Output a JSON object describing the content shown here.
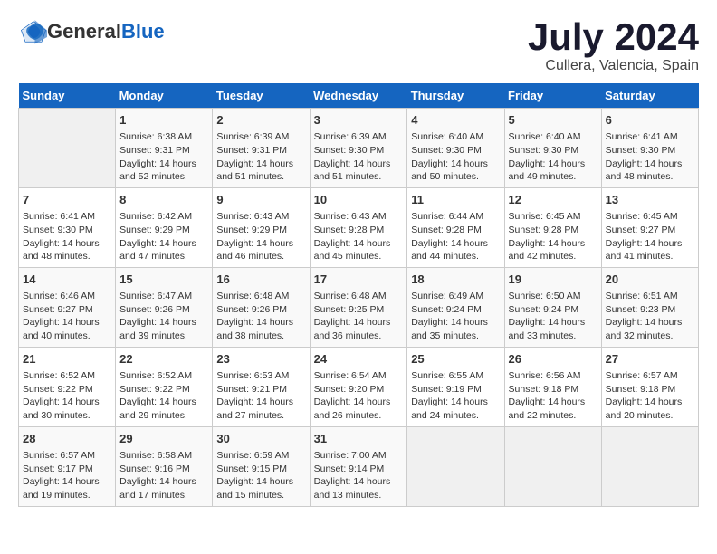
{
  "logo": {
    "general": "General",
    "blue": "Blue"
  },
  "header": {
    "month_year": "July 2024",
    "location": "Cullera, Valencia, Spain"
  },
  "weekdays": [
    "Sunday",
    "Monday",
    "Tuesday",
    "Wednesday",
    "Thursday",
    "Friday",
    "Saturday"
  ],
  "weeks": [
    [
      {
        "day": "",
        "sunrise": "",
        "sunset": "",
        "daylight": ""
      },
      {
        "day": "1",
        "sunrise": "Sunrise: 6:38 AM",
        "sunset": "Sunset: 9:31 PM",
        "daylight": "Daylight: 14 hours and 52 minutes."
      },
      {
        "day": "2",
        "sunrise": "Sunrise: 6:39 AM",
        "sunset": "Sunset: 9:31 PM",
        "daylight": "Daylight: 14 hours and 51 minutes."
      },
      {
        "day": "3",
        "sunrise": "Sunrise: 6:39 AM",
        "sunset": "Sunset: 9:30 PM",
        "daylight": "Daylight: 14 hours and 51 minutes."
      },
      {
        "day": "4",
        "sunrise": "Sunrise: 6:40 AM",
        "sunset": "Sunset: 9:30 PM",
        "daylight": "Daylight: 14 hours and 50 minutes."
      },
      {
        "day": "5",
        "sunrise": "Sunrise: 6:40 AM",
        "sunset": "Sunset: 9:30 PM",
        "daylight": "Daylight: 14 hours and 49 minutes."
      },
      {
        "day": "6",
        "sunrise": "Sunrise: 6:41 AM",
        "sunset": "Sunset: 9:30 PM",
        "daylight": "Daylight: 14 hours and 48 minutes."
      }
    ],
    [
      {
        "day": "7",
        "sunrise": "Sunrise: 6:41 AM",
        "sunset": "Sunset: 9:30 PM",
        "daylight": "Daylight: 14 hours and 48 minutes."
      },
      {
        "day": "8",
        "sunrise": "Sunrise: 6:42 AM",
        "sunset": "Sunset: 9:29 PM",
        "daylight": "Daylight: 14 hours and 47 minutes."
      },
      {
        "day": "9",
        "sunrise": "Sunrise: 6:43 AM",
        "sunset": "Sunset: 9:29 PM",
        "daylight": "Daylight: 14 hours and 46 minutes."
      },
      {
        "day": "10",
        "sunrise": "Sunrise: 6:43 AM",
        "sunset": "Sunset: 9:28 PM",
        "daylight": "Daylight: 14 hours and 45 minutes."
      },
      {
        "day": "11",
        "sunrise": "Sunrise: 6:44 AM",
        "sunset": "Sunset: 9:28 PM",
        "daylight": "Daylight: 14 hours and 44 minutes."
      },
      {
        "day": "12",
        "sunrise": "Sunrise: 6:45 AM",
        "sunset": "Sunset: 9:28 PM",
        "daylight": "Daylight: 14 hours and 42 minutes."
      },
      {
        "day": "13",
        "sunrise": "Sunrise: 6:45 AM",
        "sunset": "Sunset: 9:27 PM",
        "daylight": "Daylight: 14 hours and 41 minutes."
      }
    ],
    [
      {
        "day": "14",
        "sunrise": "Sunrise: 6:46 AM",
        "sunset": "Sunset: 9:27 PM",
        "daylight": "Daylight: 14 hours and 40 minutes."
      },
      {
        "day": "15",
        "sunrise": "Sunrise: 6:47 AM",
        "sunset": "Sunset: 9:26 PM",
        "daylight": "Daylight: 14 hours and 39 minutes."
      },
      {
        "day": "16",
        "sunrise": "Sunrise: 6:48 AM",
        "sunset": "Sunset: 9:26 PM",
        "daylight": "Daylight: 14 hours and 38 minutes."
      },
      {
        "day": "17",
        "sunrise": "Sunrise: 6:48 AM",
        "sunset": "Sunset: 9:25 PM",
        "daylight": "Daylight: 14 hours and 36 minutes."
      },
      {
        "day": "18",
        "sunrise": "Sunrise: 6:49 AM",
        "sunset": "Sunset: 9:24 PM",
        "daylight": "Daylight: 14 hours and 35 minutes."
      },
      {
        "day": "19",
        "sunrise": "Sunrise: 6:50 AM",
        "sunset": "Sunset: 9:24 PM",
        "daylight": "Daylight: 14 hours and 33 minutes."
      },
      {
        "day": "20",
        "sunrise": "Sunrise: 6:51 AM",
        "sunset": "Sunset: 9:23 PM",
        "daylight": "Daylight: 14 hours and 32 minutes."
      }
    ],
    [
      {
        "day": "21",
        "sunrise": "Sunrise: 6:52 AM",
        "sunset": "Sunset: 9:22 PM",
        "daylight": "Daylight: 14 hours and 30 minutes."
      },
      {
        "day": "22",
        "sunrise": "Sunrise: 6:52 AM",
        "sunset": "Sunset: 9:22 PM",
        "daylight": "Daylight: 14 hours and 29 minutes."
      },
      {
        "day": "23",
        "sunrise": "Sunrise: 6:53 AM",
        "sunset": "Sunset: 9:21 PM",
        "daylight": "Daylight: 14 hours and 27 minutes."
      },
      {
        "day": "24",
        "sunrise": "Sunrise: 6:54 AM",
        "sunset": "Sunset: 9:20 PM",
        "daylight": "Daylight: 14 hours and 26 minutes."
      },
      {
        "day": "25",
        "sunrise": "Sunrise: 6:55 AM",
        "sunset": "Sunset: 9:19 PM",
        "daylight": "Daylight: 14 hours and 24 minutes."
      },
      {
        "day": "26",
        "sunrise": "Sunrise: 6:56 AM",
        "sunset": "Sunset: 9:18 PM",
        "daylight": "Daylight: 14 hours and 22 minutes."
      },
      {
        "day": "27",
        "sunrise": "Sunrise: 6:57 AM",
        "sunset": "Sunset: 9:18 PM",
        "daylight": "Daylight: 14 hours and 20 minutes."
      }
    ],
    [
      {
        "day": "28",
        "sunrise": "Sunrise: 6:57 AM",
        "sunset": "Sunset: 9:17 PM",
        "daylight": "Daylight: 14 hours and 19 minutes."
      },
      {
        "day": "29",
        "sunrise": "Sunrise: 6:58 AM",
        "sunset": "Sunset: 9:16 PM",
        "daylight": "Daylight: 14 hours and 17 minutes."
      },
      {
        "day": "30",
        "sunrise": "Sunrise: 6:59 AM",
        "sunset": "Sunset: 9:15 PM",
        "daylight": "Daylight: 14 hours and 15 minutes."
      },
      {
        "day": "31",
        "sunrise": "Sunrise: 7:00 AM",
        "sunset": "Sunset: 9:14 PM",
        "daylight": "Daylight: 14 hours and 13 minutes."
      },
      {
        "day": "",
        "sunrise": "",
        "sunset": "",
        "daylight": ""
      },
      {
        "day": "",
        "sunrise": "",
        "sunset": "",
        "daylight": ""
      },
      {
        "day": "",
        "sunrise": "",
        "sunset": "",
        "daylight": ""
      }
    ]
  ]
}
